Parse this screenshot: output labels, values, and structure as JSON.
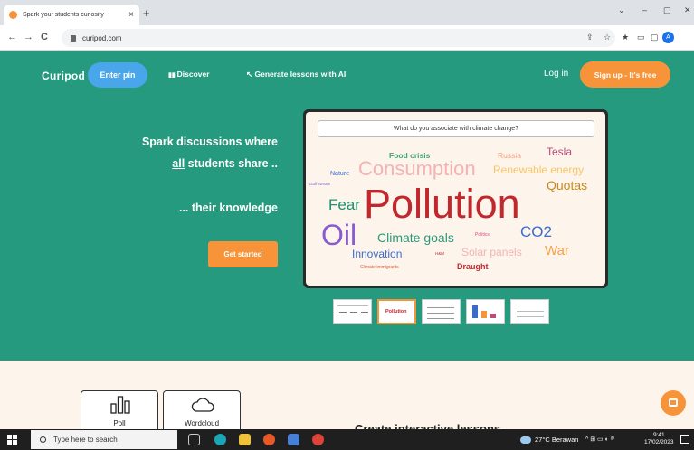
{
  "browser": {
    "tab_title": "Spark your students curiosity",
    "tab_close": "×",
    "new_tab": "+",
    "url": "curipod.com",
    "window_controls": [
      "⌄",
      "–",
      "▢",
      "✕"
    ],
    "nav": {
      "back": "←",
      "forward": "→",
      "reload": "C"
    },
    "toolbar_icons": [
      "⇪",
      "☆",
      "★",
      "▭",
      "▢"
    ],
    "profile_initial": "A"
  },
  "header": {
    "logo": "Curipod",
    "enter_pin": "Enter pin",
    "discover": "Discover",
    "generate": "Generate lessons with AI",
    "login": "Log in",
    "signup": "Sign up - It's free"
  },
  "hero": {
    "line1": "Spark discussions where",
    "line2_underlined": "all",
    "line2_rest": " students share ..",
    "line3": "... their knowledge",
    "cta": "Get started"
  },
  "wordcloud": {
    "question": "What do you associate with climate change?",
    "words": [
      {
        "text": "Food crisis",
        "color": "#3aa87a"
      },
      {
        "text": "Russia",
        "color": "#f2a07b"
      },
      {
        "text": "Tesla",
        "color": "#c04a7a"
      },
      {
        "text": "Nature",
        "color": "#3b6cc9"
      },
      {
        "text": "Consumption",
        "color": "#f4b3b3"
      },
      {
        "text": "Renewable energy",
        "color": "#f6c56a"
      },
      {
        "text": "Gulf stream",
        "color": "#7a6ad0"
      },
      {
        "text": "Quotas",
        "color": "#c88a1a"
      },
      {
        "text": "Fear",
        "color": "#1f8f6f"
      },
      {
        "text": "Pollution",
        "color": "#c0282d"
      },
      {
        "text": "Oil",
        "color": "#8a5ad0"
      },
      {
        "text": "Climate goals",
        "color": "#2a9a7a"
      },
      {
        "text": "CO2",
        "color": "#3b6cc9"
      },
      {
        "text": "Politics",
        "color": "#e0457a"
      },
      {
        "text": "Innovation",
        "color": "#3b6cc9"
      },
      {
        "text": "H&M",
        "color": "#c0282d"
      },
      {
        "text": "Solar panels",
        "color": "#f4b3b3"
      },
      {
        "text": "War",
        "color": "#f4a24a"
      },
      {
        "text": "Climate immigrants",
        "color": "#e05a3a"
      },
      {
        "text": "Draught",
        "color": "#c0282d"
      }
    ]
  },
  "thumb_active_label": "Pollution",
  "features": {
    "cards": [
      {
        "label": "Poll",
        "icon": "bar-chart-icon"
      },
      {
        "label": "Wordcloud",
        "icon": "cloud-icon"
      }
    ],
    "heading_partial": "Create interactive lessons"
  },
  "taskbar": {
    "search_placeholder": "Type here to search",
    "weather": "27°C  Berawan",
    "tray": "^  ⊞  ▭  ◐  ᵈ⁾",
    "time": "9:41",
    "date": "17/02/2023"
  },
  "colors": {
    "hero_bg": "#259a7e",
    "accent_orange": "#f7943a",
    "pin_blue": "#4aa6ea",
    "lower_bg": "#fdf4ec"
  }
}
